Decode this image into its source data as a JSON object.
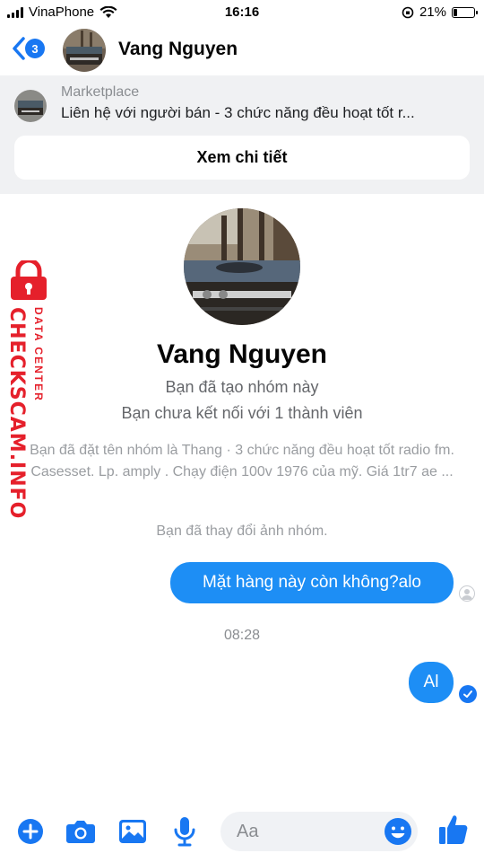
{
  "status_bar": {
    "carrier": "VinaPhone",
    "time": "16:16",
    "battery": "21%",
    "battery_level": 0.21
  },
  "header": {
    "back_badge": "3",
    "title": "Vang Nguyen"
  },
  "marketplace": {
    "label": "Marketplace",
    "description": "Liên hệ với người bán - 3 chức năng đều hoạt tốt r...",
    "button_label": "Xem chi tiết"
  },
  "profile": {
    "name": "Vang Nguyen",
    "line1": "Bạn đã tạo nhóm này",
    "line2": "Bạn chưa kết nối với 1 thành viên"
  },
  "system_messages": {
    "rename": "Bạn đã đặt tên nhóm là Thang · 3 chức năng đều hoạt tốt radio fm. Casesset. Lp. amply . Chạy điện 100v 1976 của mỹ. Giá 1tr7 ae ...",
    "photo_change": "Bạn đã thay đổi ảnh nhóm."
  },
  "messages": [
    {
      "text": "Mặt hàng này còn không?alo"
    },
    {
      "text": "Al"
    }
  ],
  "timestamp": "08:28",
  "composer": {
    "placeholder": "Aa"
  },
  "watermark": {
    "brand": "CHECKSCAM.INFO",
    "sub": "DATA CENTER"
  },
  "colors": {
    "accent": "#1877f2",
    "bubble": "#1d8ef5",
    "watermark": "#e5202b"
  }
}
